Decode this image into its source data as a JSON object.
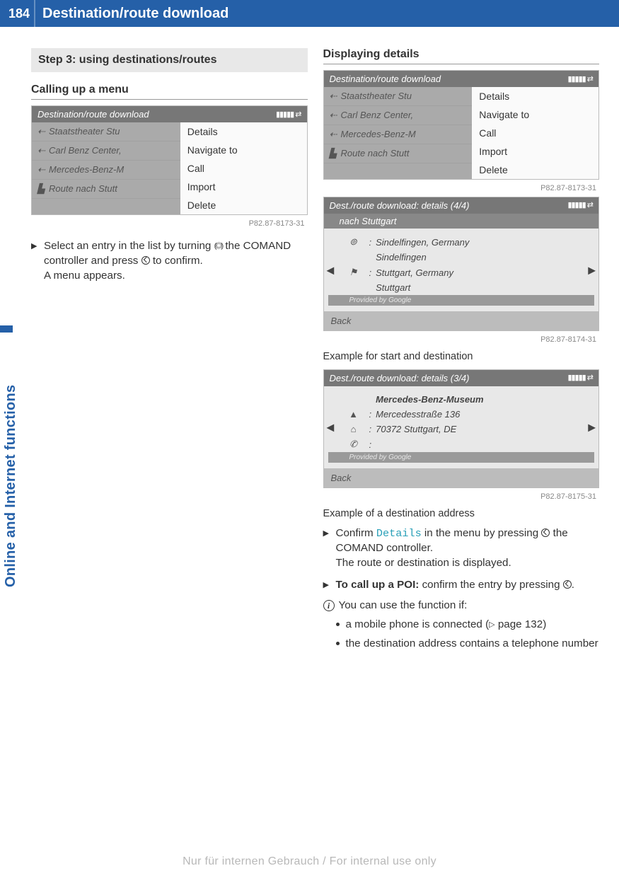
{
  "header": {
    "page_number": "184",
    "title": "Destination/route download"
  },
  "side_tab": "Online and Internet functions",
  "left": {
    "step_title": "Step 3: using destinations/routes",
    "sub_heading": "Calling up a menu",
    "screen1": {
      "title": "Destination/route download",
      "left_items": [
        "Staatstheater Stu",
        "Carl Benz Center,",
        "Mercedes-Benz-M",
        "Route nach Stutt"
      ],
      "right_items": [
        "Details",
        "Navigate to",
        "Call",
        "Import",
        "Delete"
      ],
      "caption": "P82.87-8173-31"
    },
    "proc1_a": "Select an entry in the list by turning ",
    "proc1_b": " the COMAND controller and press ",
    "proc1_c": " to confirm.",
    "proc1_d": "A menu appears."
  },
  "right": {
    "h_details": "Displaying details",
    "screen1": {
      "title": "Destination/route download",
      "left_items": [
        "Staatstheater Stu",
        "Carl Benz Center,",
        "Mercedes-Benz-M",
        "Route nach Stutt"
      ],
      "right_items": [
        "Details",
        "Navigate to",
        "Call",
        "Import",
        "Delete"
      ],
      "caption": "P82.87-8173-31"
    },
    "screen2": {
      "title": "Dest./route download: details (4/4)",
      "subtitle": "nach Stuttgart",
      "lines": [
        {
          "label": "Sindelfingen, Germany"
        },
        {
          "label": "Sindelfingen"
        },
        {
          "label": "Stuttgart, Germany"
        },
        {
          "label": "Stuttgart"
        }
      ],
      "provided": "Provided by Google",
      "back": "Back",
      "caption": "P82.87-8174-31"
    },
    "caption2": "Example for start and destination",
    "screen3": {
      "title": "Dest./route download: details (3/4)",
      "name": "Mercedes-Benz-Museum",
      "addr1": "Mercedesstraße 136",
      "addr2": "70372 Stuttgart, DE",
      "provided": "Provided by Google",
      "back": "Back",
      "caption": "P82.87-8175-31"
    },
    "caption3": "Example of a destination address",
    "proc2_a": "Confirm ",
    "proc2_details": "Details",
    "proc2_b": " in the menu by pressing ",
    "proc2_c": " the COMAND controller.",
    "proc2_d": "The route or destination is displayed.",
    "proc3_bold": "To call up a POI:",
    "proc3_a": " confirm the entry by pressing ",
    "proc3_b": ".",
    "info": "You can use the function if:",
    "bullet1a": "a mobile phone is connected (",
    "bullet1_page": "page 132",
    "bullet1b": ")",
    "bullet2": "the destination address contains a telephone number"
  },
  "footer": "Nur für internen Gebrauch / For internal use only"
}
